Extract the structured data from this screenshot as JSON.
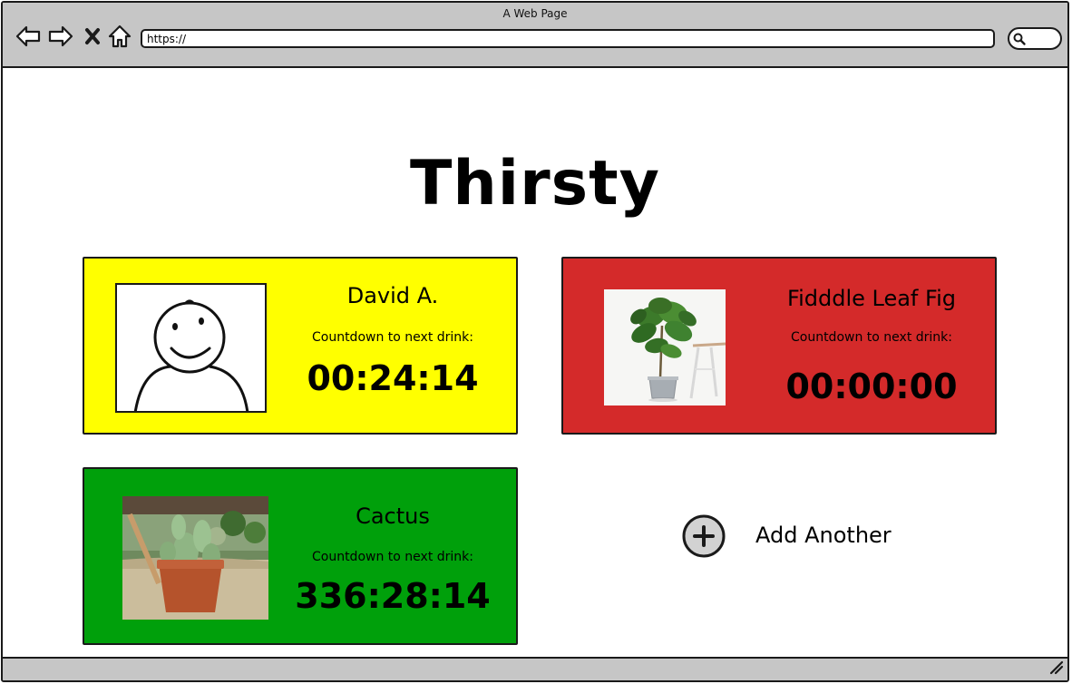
{
  "browser": {
    "window_title": "A Web Page",
    "url": "https://",
    "icons": {
      "back": "back-arrow-icon",
      "forward": "forward-arrow-icon",
      "stop": "close-icon",
      "home": "home-icon",
      "search": "search-icon",
      "resize": "resize-grip-icon"
    }
  },
  "page": {
    "title": "Thirsty"
  },
  "cards": [
    {
      "name": "David A.",
      "label": "Countdown to next drink:",
      "timer": "00:24:14",
      "color": "#ffff00",
      "image": "smiley-avatar"
    },
    {
      "name": "Fidddle Leaf Fig",
      "label": "Countdown to next drink:",
      "timer": "00:00:00",
      "color": "#d42a2a",
      "image": "fiddle-leaf-fig-photo"
    },
    {
      "name": "Cactus",
      "label": "Countdown to next drink:",
      "timer": "336:28:14",
      "color": "#00a00b",
      "image": "cactus-photo"
    }
  ],
  "add_another": {
    "label": "Add Another",
    "icon": "plus-circle-icon"
  }
}
